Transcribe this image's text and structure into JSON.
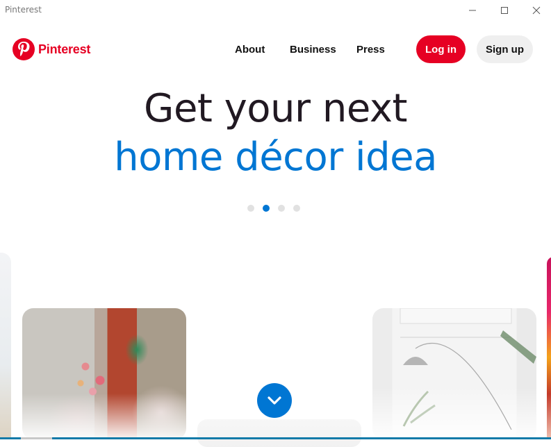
{
  "window": {
    "title": "Pinterest",
    "controls": [
      "minimize",
      "maximize",
      "close"
    ]
  },
  "header": {
    "logo_text": "Pinterest",
    "logo_icon": "pinterest-logo-icon",
    "nav": [
      {
        "label": "About"
      },
      {
        "label": "Business"
      },
      {
        "label": "Press"
      }
    ],
    "login_label": "Log in",
    "signup_label": "Sign up"
  },
  "hero": {
    "line1": "Get your next",
    "line2": "home décor idea",
    "carousel": {
      "count": 4,
      "active_index": 1
    }
  },
  "gallery": {
    "cards": [
      {
        "subject": "partial image left edge"
      },
      {
        "subject": "patterned pillows with flowers and ornate door"
      },
      {
        "subject": "partial image bottom center"
      },
      {
        "subject": "white room with arc floor lamp and plant"
      },
      {
        "subject": "partial colorful image right edge"
      }
    ],
    "scroll_button_icon": "chevron-down-icon"
  },
  "colors": {
    "brand_red": "#e60023",
    "accent_blue": "#0076d3",
    "heading_dark": "#211922",
    "signup_bg": "#efefef",
    "dot_inactive": "#e1e1e1"
  }
}
